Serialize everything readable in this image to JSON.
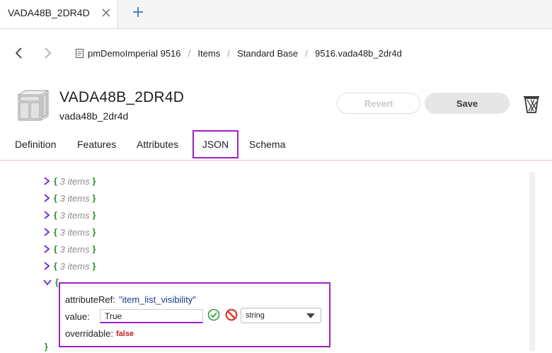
{
  "tab": {
    "title": "VADA48B_2DR4D"
  },
  "breadcrumb": {
    "items": [
      "pmDemoImperial 9516",
      "Items",
      "Standard Base",
      "9516.vada48b_2dr4d"
    ]
  },
  "item": {
    "title": "VADA48B_2DR4D",
    "subtitle": "vada48b_2dr4d"
  },
  "actions": {
    "revert": "Revert",
    "save": "Save"
  },
  "maintabs": [
    "Definition",
    "Features",
    "Attributes",
    "JSON",
    "Schema"
  ],
  "tree": {
    "open_brace": "{",
    "close_brace": "}",
    "collapsed_items": [
      "3 items",
      "3 items",
      "3 items",
      "3 items",
      "3 items",
      "3 items"
    ]
  },
  "edit": {
    "attributeRef_label": "attributeRef:",
    "attributeRef_value": "\"item_list_visibility\"",
    "value_label": "value:",
    "value_input": "True",
    "type_select": "string",
    "overridable_label": "overridable:",
    "overridable_value": "false"
  },
  "colors": {
    "accent": "#a020c8",
    "brace": "#1a8a1a",
    "false_value": "#c51b1b",
    "chevron": "#6a2bc9"
  }
}
